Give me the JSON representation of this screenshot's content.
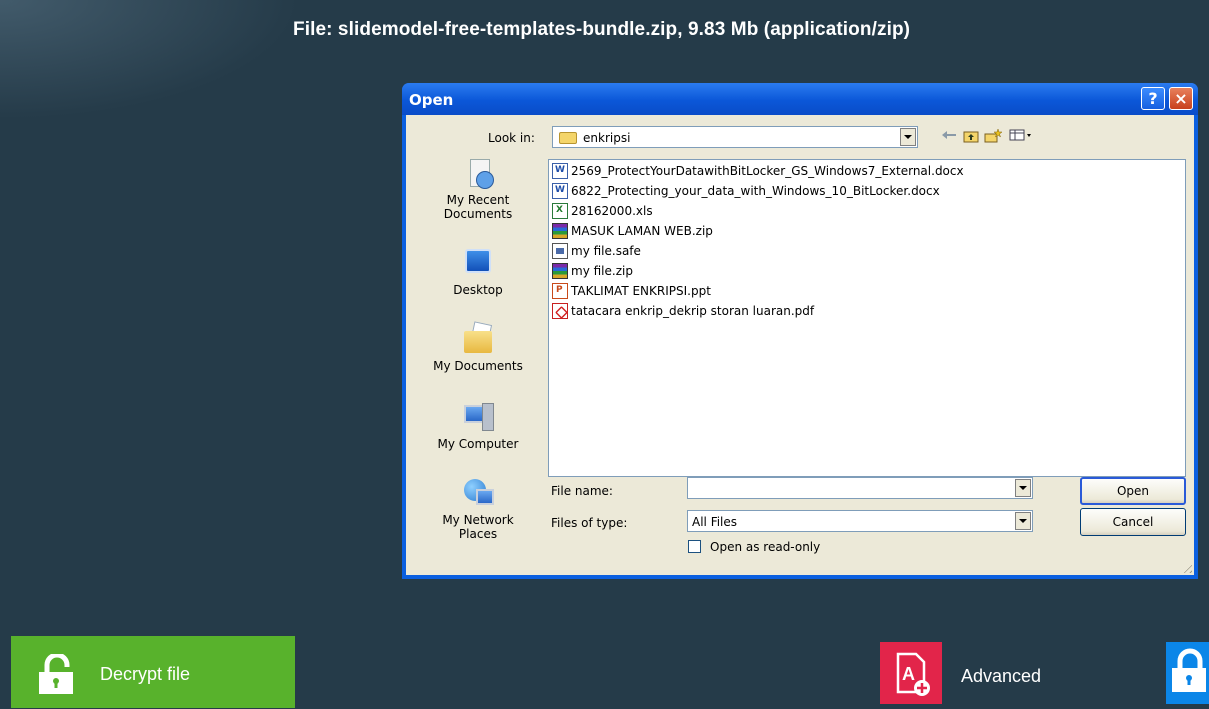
{
  "header": {
    "file_info": "File: slidemodel-free-templates-bundle.zip, 9.83 Mb (application/zip)"
  },
  "dialog": {
    "title": "Open",
    "help_label": "?",
    "close_label": "×",
    "look_in_label": "Look in:",
    "look_in_value": "enkripsi",
    "places": [
      {
        "label": "My Recent Documents"
      },
      {
        "label": "Desktop"
      },
      {
        "label": "My Documents"
      },
      {
        "label": "My Computer"
      },
      {
        "label": "My Network Places"
      }
    ],
    "files": [
      {
        "name": "2569_ProtectYourDatawithBitLocker_GS_Windows7_External.docx",
        "icon": "docx"
      },
      {
        "name": "6822_Protecting_your_data_with_Windows_10_BitLocker.docx",
        "icon": "docx"
      },
      {
        "name": "28162000.xls",
        "icon": "xls"
      },
      {
        "name": "MASUK LAMAN WEB.zip",
        "icon": "zip"
      },
      {
        "name": "my file.safe",
        "icon": "safe"
      },
      {
        "name": "my file.zip",
        "icon": "zip"
      },
      {
        "name": "TAKLIMAT ENKRIPSI.ppt",
        "icon": "ppt"
      },
      {
        "name": "tatacara enkrip_dekrip storan luaran.pdf",
        "icon": "pdf"
      }
    ],
    "file_name_label": "File name:",
    "file_name_value": "",
    "file_type_label": "Files of type:",
    "file_type_value": "All Files",
    "read_only_label": "Open as read-only",
    "read_only_checked": false,
    "open_button": "Open",
    "cancel_button": "Cancel"
  },
  "bottom": {
    "decrypt_label": "Decrypt file",
    "advanced_label": "Advanced"
  },
  "colors": {
    "background": "#253b49",
    "decrypt": "#58b22c",
    "advanced": "#e2254a",
    "encrypt": "#0b86e8",
    "dialog_frame": "#0a5fe0"
  }
}
